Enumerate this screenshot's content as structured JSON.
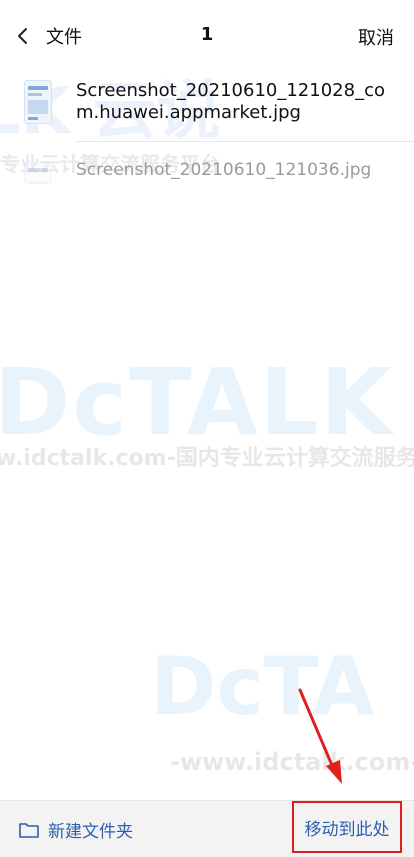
{
  "header": {
    "back_label": "文件",
    "count": "1",
    "cancel_label": "取消"
  },
  "files": [
    {
      "name": "Screenshot_20210610_121028_com.huawei.appmarket.jpg",
      "selected": true
    },
    {
      "name": "Screenshot_20210610_121036.jpg",
      "selected": false
    }
  ],
  "watermark": {
    "brand": "LK 云说",
    "tagline_short": "专业云计算交流服务平台",
    "logo": "DcTALK 云说",
    "url_line": "w.idctalk.com-国内专业云计算交流服务",
    "logo2": "DcTA",
    "url_line2": "-www.idctalk.com-国"
  },
  "bottom": {
    "new_folder_label": "新建文件夹",
    "move_here_label": "移动到此处"
  },
  "colors": {
    "accent": "#2d5fb0",
    "highlight_box": "#e02020"
  },
  "icons": {
    "back": "chevron-left-icon",
    "folder": "folder-icon",
    "annotation": "red-arrow-icon"
  }
}
